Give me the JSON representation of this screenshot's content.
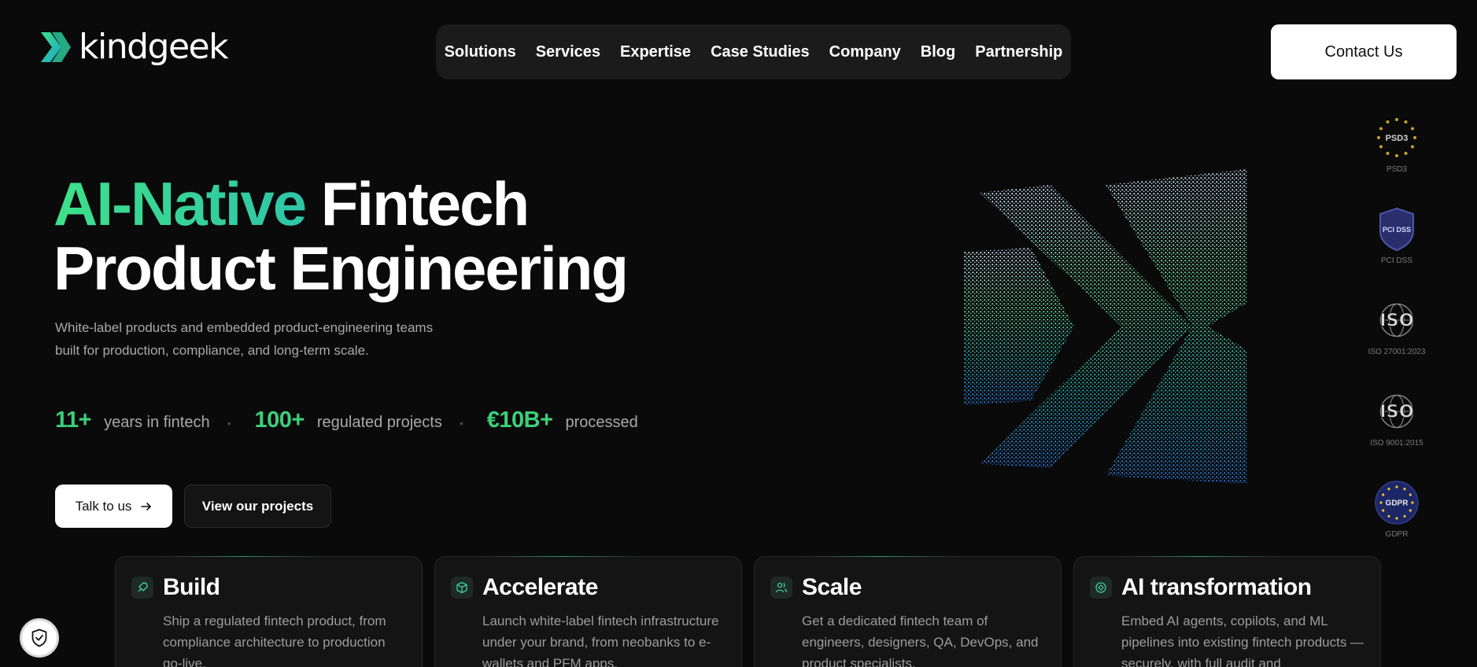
{
  "brand": {
    "name": "kindgeek"
  },
  "nav": {
    "items": [
      "Solutions",
      "Services",
      "Expertise",
      "Case Studies",
      "Company",
      "Blog",
      "Partnership"
    ],
    "contact_label": "Contact Us"
  },
  "hero": {
    "title_accent": "AI-Native",
    "title_rest_line1": " Fintech",
    "title_line2": "Product Engineering",
    "subtitle_line1": "White-label products and embedded product-engineering teams",
    "subtitle_line2": "built for production, compliance, and long-term scale.",
    "stats": [
      {
        "value": "11+",
        "label": "years in fintech"
      },
      {
        "value": "100+",
        "label": "regulated projects"
      },
      {
        "value": "€10B+",
        "label": "processed"
      }
    ],
    "primary_cta": "Talk to us",
    "secondary_cta": "View our projects"
  },
  "badges": [
    {
      "label": "PSD3",
      "icon": "psd3-badge-icon",
      "mark": "PSD3"
    },
    {
      "label": "PCI DSS",
      "icon": "pci-dss-badge-icon",
      "mark": "PCI DSS"
    },
    {
      "label": "ISO 27001:2023",
      "icon": "iso-badge-icon",
      "mark": "ISO"
    },
    {
      "label": "ISO 9001:2015",
      "icon": "iso-badge-icon",
      "mark": "ISO"
    },
    {
      "label": "GDPR",
      "icon": "gdpr-badge-icon",
      "mark": "GDPR"
    }
  ],
  "cards": [
    {
      "title": "Build",
      "icon": "rocket-icon",
      "text": "Ship a regulated fintech product, from compliance architecture to production go-live."
    },
    {
      "title": "Accelerate",
      "icon": "cube-icon",
      "text": "Launch white-label fintech infrastructure under your brand, from neobanks to e-wallets and PFM apps."
    },
    {
      "title": "Scale",
      "icon": "users-icon",
      "text": "Get a dedicated fintech team of engineers, designers, QA, DevOps, and product specialists."
    },
    {
      "title": "AI transformation",
      "icon": "ai-brain-icon",
      "text": "Embed AI agents, copilots, and ML pipelines into existing fintech products — securely, with full audit and"
    }
  ],
  "colors": {
    "accent_green": "#3ccf7a",
    "accent_teal": "#2fc5a8",
    "background": "#0a0a0a"
  }
}
